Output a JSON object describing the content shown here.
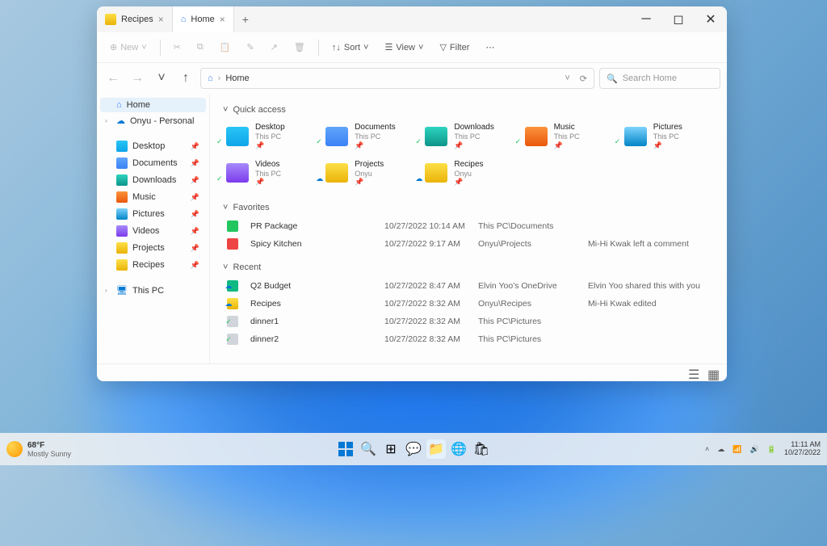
{
  "tabs": [
    {
      "label": "Recipes",
      "icon": "f-yellow"
    },
    {
      "label": "Home",
      "icon": "home",
      "active": true
    }
  ],
  "toolbar": {
    "new": "New",
    "sort": "Sort",
    "view": "View",
    "filter": "Filter"
  },
  "address": {
    "location": "Home",
    "search_placeholder": "Search Home"
  },
  "sidebar": {
    "top": [
      {
        "label": "Home",
        "icon": "home",
        "active": true
      },
      {
        "label": "Onyu - Personal",
        "icon": "onedrive",
        "chev": true
      }
    ],
    "pinned": [
      {
        "label": "Desktop",
        "color": "f-cyan"
      },
      {
        "label": "Documents",
        "color": "f-blue"
      },
      {
        "label": "Downloads",
        "color": "f-teal"
      },
      {
        "label": "Music",
        "color": "f-orange"
      },
      {
        "label": "Pictures",
        "color": "f-sky"
      },
      {
        "label": "Videos",
        "color": "f-purple"
      },
      {
        "label": "Projects",
        "color": "f-yellow"
      },
      {
        "label": "Recipes",
        "color": "f-yellow"
      }
    ],
    "thispc": "This PC"
  },
  "sections": {
    "quick_access": "Quick access",
    "favorites": "Favorites",
    "recent": "Recent"
  },
  "quick_access": [
    {
      "name": "Desktop",
      "sub": "This PC",
      "color": "f-cyan"
    },
    {
      "name": "Documents",
      "sub": "This PC",
      "color": "f-blue"
    },
    {
      "name": "Downloads",
      "sub": "This PC",
      "color": "f-teal"
    },
    {
      "name": "Music",
      "sub": "This PC",
      "color": "f-orange"
    },
    {
      "name": "Pictures",
      "sub": "This PC",
      "color": "f-sky"
    },
    {
      "name": "Videos",
      "sub": "This PC",
      "color": "f-purple"
    },
    {
      "name": "Projects",
      "sub": "Onyu",
      "color": "f-yellow",
      "cloud": true
    },
    {
      "name": "Recipes",
      "sub": "Onyu",
      "color": "f-yellow",
      "cloud": true
    }
  ],
  "favorites": [
    {
      "name": "PR Package",
      "date": "10/27/2022 10:14 AM",
      "loc": "This PC\\Documents",
      "activity": ""
    },
    {
      "name": "Spicy Kitchen",
      "date": "10/27/2022 9:17 AM",
      "loc": "Onyu\\Projects",
      "activity": "Mi-Hi Kwak left a comment"
    }
  ],
  "recent": [
    {
      "name": "Q2 Budget",
      "date": "10/27/2022 8:47 AM",
      "loc": "Elvin Yoo's OneDrive",
      "activity": "Elvin Yoo shared this with you",
      "icon": "f-excel",
      "cloud": true
    },
    {
      "name": "Recipes",
      "date": "10/27/2022 8:32 AM",
      "loc": "Onyu\\Recipes",
      "activity": "Mi-Hi Kwak edited",
      "icon": "f-yellow",
      "cloud": true
    },
    {
      "name": "dinner1",
      "date": "10/27/2022 8:32 AM",
      "loc": "This PC\\Pictures",
      "activity": "",
      "icon": "f-gray",
      "badge": true
    },
    {
      "name": "dinner2",
      "date": "10/27/2022 8:32 AM",
      "loc": "This PC\\Pictures",
      "activity": "",
      "icon": "f-gray",
      "badge": true
    }
  ],
  "taskbar": {
    "weather_temp": "68°F",
    "weather_desc": "Mostly Sunny",
    "time": "11:11 AM",
    "date": "10/27/2022"
  }
}
